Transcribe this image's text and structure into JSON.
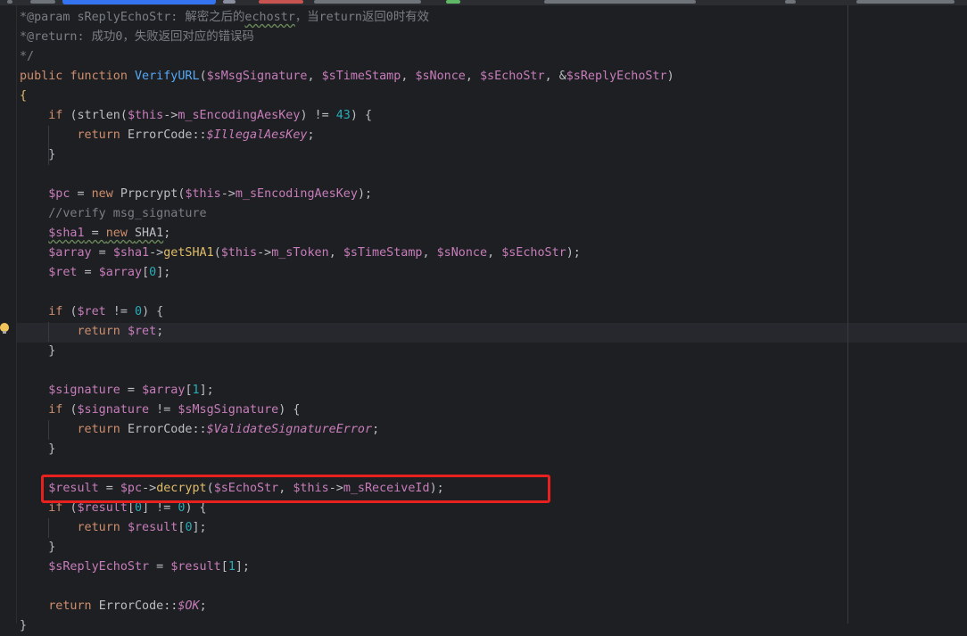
{
  "editor": {
    "lines": [
      [
        [
          "cm",
          "*@param sReplyEchoStr: 解密之后的"
        ],
        [
          "cm warn",
          "echostr"
        ],
        [
          "cm",
          "，当return返回0时有效"
        ]
      ],
      [
        [
          "cm",
          "*@return: 成功0，失败返回对应的错误码"
        ]
      ],
      [
        [
          "cm",
          "*/"
        ]
      ],
      [
        [
          "kw",
          "public "
        ],
        [
          "kw",
          "function "
        ],
        [
          "fn",
          "VerifyURL"
        ],
        [
          "paren",
          "("
        ],
        [
          "var",
          "$sMsgSignature"
        ],
        [
          "op",
          ", "
        ],
        [
          "var",
          "$sTimeStamp"
        ],
        [
          "op",
          ", "
        ],
        [
          "var",
          "$sNonce"
        ],
        [
          "op",
          ", "
        ],
        [
          "var",
          "$sEchoStr"
        ],
        [
          "op",
          ", "
        ],
        [
          "op",
          "&"
        ],
        [
          "var",
          "$sReplyEchoStr"
        ],
        [
          "paren",
          ")"
        ]
      ],
      [
        [
          "brace-y",
          "{"
        ]
      ],
      [
        [
          "op",
          "    "
        ],
        [
          "kw",
          "if "
        ],
        [
          "paren",
          "("
        ],
        [
          "op",
          "strlen("
        ],
        [
          "ivar",
          "$this"
        ],
        [
          "op",
          "->"
        ],
        [
          "prop",
          "m_sEncodingAesKey"
        ],
        [
          "op",
          ") != "
        ],
        [
          "num",
          "43"
        ],
        [
          "op",
          ") {"
        ]
      ],
      [
        [
          "op",
          "        "
        ],
        [
          "kw",
          "return "
        ],
        [
          "cls",
          "ErrorCode::"
        ],
        [
          "const",
          "$IllegalAesKey"
        ],
        [
          "op",
          ";"
        ]
      ],
      [
        [
          "op",
          "    }"
        ]
      ],
      [
        [
          "op",
          ""
        ]
      ],
      [
        [
          "op",
          "    "
        ],
        [
          "var",
          "$pc"
        ],
        [
          "op",
          " = "
        ],
        [
          "kw",
          "new "
        ],
        [
          "cls",
          "Prpcrypt("
        ],
        [
          "ivar",
          "$this"
        ],
        [
          "op",
          "->"
        ],
        [
          "prop",
          "m_sEncodingAesKey"
        ],
        [
          "op",
          ");"
        ]
      ],
      [
        [
          "op",
          "    "
        ],
        [
          "cm",
          "//verify msg_signature"
        ]
      ],
      [
        [
          "op",
          "    "
        ],
        [
          "var warn",
          "$sha1"
        ],
        [
          "op warn",
          " = "
        ],
        [
          "kw warn",
          "new "
        ],
        [
          "cls warn",
          "SHA1"
        ],
        [
          "op",
          ";"
        ]
      ],
      [
        [
          "op",
          "    "
        ],
        [
          "var",
          "$array"
        ],
        [
          "op",
          " = "
        ],
        [
          "var",
          "$sha1"
        ],
        [
          "op",
          "->"
        ],
        [
          "mcall",
          "getSHA1"
        ],
        [
          "op",
          "("
        ],
        [
          "ivar",
          "$this"
        ],
        [
          "op",
          "->"
        ],
        [
          "prop",
          "m_sToken"
        ],
        [
          "op",
          ", "
        ],
        [
          "var",
          "$sTimeStamp"
        ],
        [
          "op",
          ", "
        ],
        [
          "var",
          "$sNonce"
        ],
        [
          "op",
          ", "
        ],
        [
          "var",
          "$sEchoStr"
        ],
        [
          "op",
          ");"
        ]
      ],
      [
        [
          "op",
          "    "
        ],
        [
          "var",
          "$ret"
        ],
        [
          "op",
          " = "
        ],
        [
          "var",
          "$array"
        ],
        [
          "op",
          "["
        ],
        [
          "num",
          "0"
        ],
        [
          "op",
          "];"
        ]
      ],
      [
        [
          "op",
          ""
        ]
      ],
      [
        [
          "op",
          "    "
        ],
        [
          "kw",
          "if "
        ],
        [
          "op",
          "("
        ],
        [
          "var",
          "$ret"
        ],
        [
          "op",
          " != "
        ],
        [
          "num",
          "0"
        ],
        [
          "op",
          ") {"
        ]
      ],
      [
        [
          "op",
          "        "
        ],
        [
          "kw",
          "return "
        ],
        [
          "var",
          "$ret"
        ],
        [
          "op",
          ";"
        ]
      ],
      [
        [
          "op",
          "    }"
        ]
      ],
      [
        [
          "op",
          ""
        ]
      ],
      [
        [
          "op",
          "    "
        ],
        [
          "var",
          "$signature"
        ],
        [
          "op",
          " = "
        ],
        [
          "var",
          "$array"
        ],
        [
          "op",
          "["
        ],
        [
          "num",
          "1"
        ],
        [
          "op",
          "];"
        ]
      ],
      [
        [
          "op",
          "    "
        ],
        [
          "kw",
          "if "
        ],
        [
          "op",
          "("
        ],
        [
          "var",
          "$signature"
        ],
        [
          "op",
          " != "
        ],
        [
          "var",
          "$sMsgSignature"
        ],
        [
          "op",
          ") {"
        ]
      ],
      [
        [
          "op",
          "        "
        ],
        [
          "kw",
          "return "
        ],
        [
          "cls",
          "ErrorCode::"
        ],
        [
          "const",
          "$ValidateSignatureError"
        ],
        [
          "op",
          ";"
        ]
      ],
      [
        [
          "op",
          "    }"
        ]
      ],
      [
        [
          "op",
          ""
        ]
      ],
      [
        [
          "op",
          "    "
        ],
        [
          "var",
          "$result"
        ],
        [
          "op",
          " = "
        ],
        [
          "var",
          "$pc"
        ],
        [
          "op",
          "->"
        ],
        [
          "mcall",
          "decrypt"
        ],
        [
          "op",
          "("
        ],
        [
          "var",
          "$sEchoStr"
        ],
        [
          "op",
          ", "
        ],
        [
          "ivar",
          "$this"
        ],
        [
          "op",
          "->"
        ],
        [
          "prop",
          "m_sReceiveId"
        ],
        [
          "op",
          ");"
        ]
      ],
      [
        [
          "op",
          "    "
        ],
        [
          "kw",
          "if "
        ],
        [
          "op",
          "("
        ],
        [
          "var",
          "$result"
        ],
        [
          "op",
          "["
        ],
        [
          "num",
          "0"
        ],
        [
          "op",
          "] != "
        ],
        [
          "num",
          "0"
        ],
        [
          "op",
          ") {"
        ]
      ],
      [
        [
          "op",
          "        "
        ],
        [
          "kw",
          "return "
        ],
        [
          "var",
          "$result"
        ],
        [
          "op",
          "["
        ],
        [
          "num",
          "0"
        ],
        [
          "op",
          "];"
        ]
      ],
      [
        [
          "op",
          "    }"
        ]
      ],
      [
        [
          "op",
          "    "
        ],
        [
          "var",
          "$sReplyEchoStr"
        ],
        [
          "op",
          " = "
        ],
        [
          "var",
          "$result"
        ],
        [
          "op",
          "["
        ],
        [
          "num",
          "1"
        ],
        [
          "op",
          "];"
        ]
      ],
      [
        [
          "op",
          ""
        ]
      ],
      [
        [
          "op",
          "    "
        ],
        [
          "kw",
          "return "
        ],
        [
          "cls",
          "ErrorCode::"
        ],
        [
          "const",
          "$OK"
        ],
        [
          "op",
          ";"
        ]
      ],
      [
        [
          "op",
          "}"
        ]
      ]
    ]
  }
}
